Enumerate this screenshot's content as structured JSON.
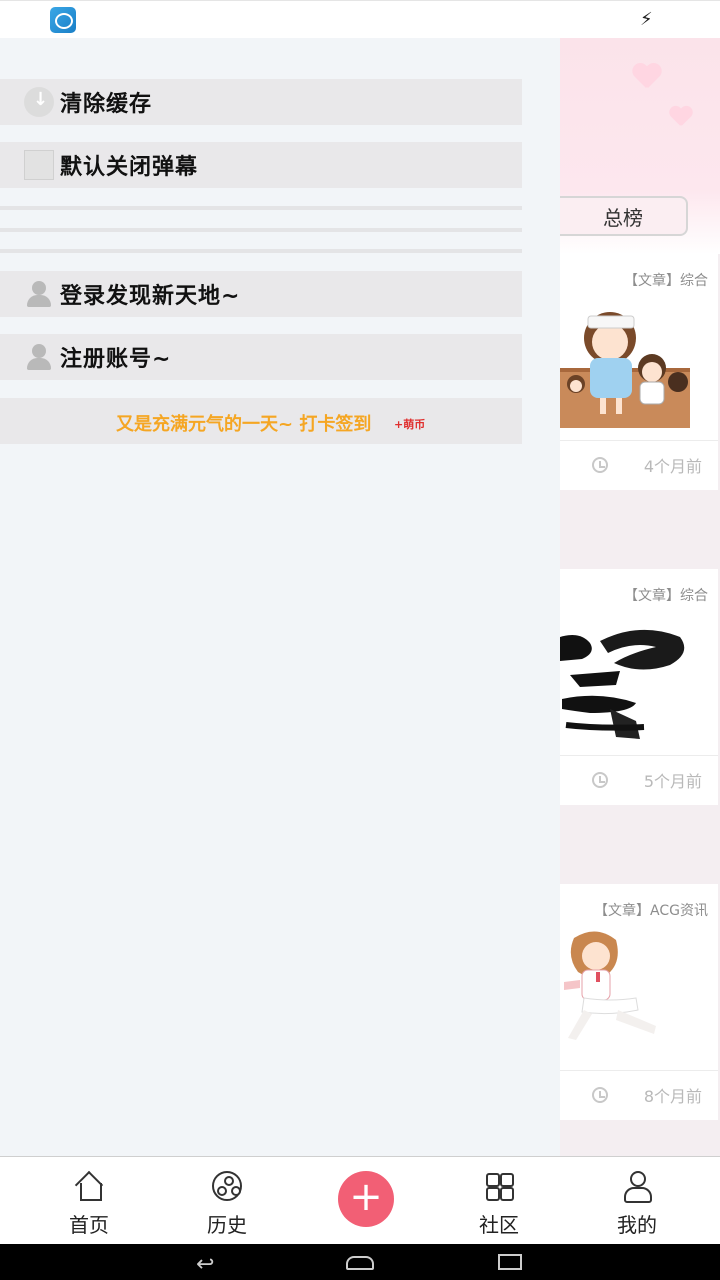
{
  "status_bar": {
    "left_icon": "nox-app-icon",
    "right_icon": "battery-charging-icon",
    "battery_glyph": "⚡"
  },
  "drawer": {
    "menu": [
      {
        "label": "清除缓存",
        "icon": "cloud-download-icon"
      },
      {
        "label": "默认关闭弹幕",
        "icon": "danmaku-icon"
      },
      {
        "label": "登录发现新天地~",
        "icon": "person-icon"
      },
      {
        "label": "注册账号~",
        "icon": "person-icon"
      }
    ],
    "checkin": {
      "text": "又是充满元气的一天~ 打卡签到",
      "bonus": "+萌币",
      "text_color": "#f5a623",
      "bonus_color": "#e0302f"
    }
  },
  "feed": {
    "ranking_tab_label": "总榜",
    "cards": [
      {
        "tag": "【文章】综合",
        "time": "4个月前",
        "image": "anime-girls-illustration"
      },
      {
        "tag": "【文章】综合",
        "time": "5个月前",
        "image": "calligraphy-brush-character"
      },
      {
        "tag": "【文章】ACG资讯",
        "time": "8个月前",
        "image": "anime-figure-photo"
      }
    ]
  },
  "tab_bar": {
    "tabs": [
      {
        "label": "首页",
        "icon": "home-icon"
      },
      {
        "label": "历史",
        "icon": "film-reel-icon"
      },
      {
        "label": "社区",
        "icon": "grid-icon"
      },
      {
        "label": "我的",
        "icon": "profile-icon"
      }
    ],
    "center_button": {
      "glyph": "+",
      "icon": "add-icon",
      "color": "#f25f75"
    }
  },
  "system_nav": {
    "back_glyph": "↩",
    "icons": [
      "back-icon",
      "home-icon",
      "recent-apps-icon"
    ]
  }
}
